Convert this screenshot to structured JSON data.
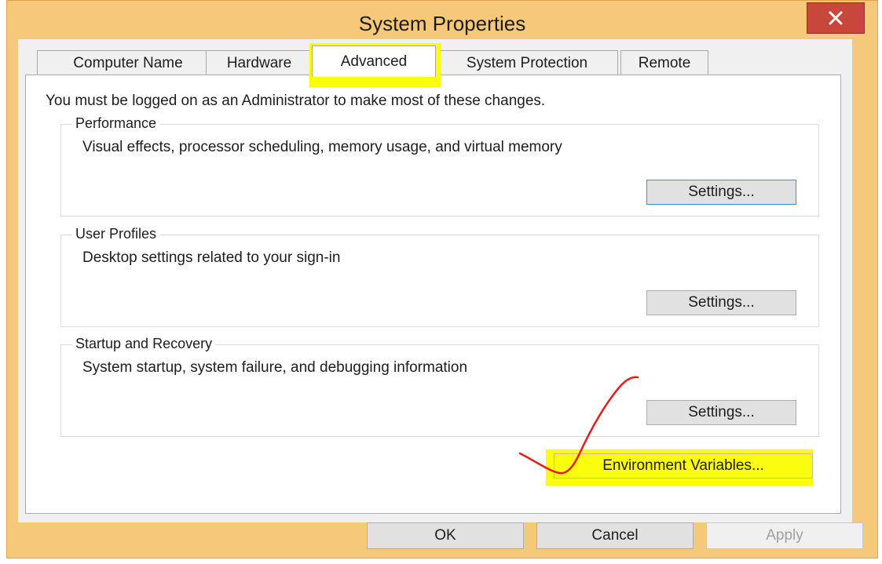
{
  "window": {
    "title": "System Properties"
  },
  "tabs": [
    {
      "label": "Computer Name",
      "active": false
    },
    {
      "label": "Hardware",
      "active": false
    },
    {
      "label": "Advanced",
      "active": true
    },
    {
      "label": "System Protection",
      "active": false
    },
    {
      "label": "Remote",
      "active": false
    }
  ],
  "admin_note": "You must be logged on as an Administrator to make most of these changes.",
  "groups": {
    "performance": {
      "title": "Performance",
      "description": "Visual effects, processor scheduling, memory usage, and virtual memory",
      "button": "Settings..."
    },
    "user_profiles": {
      "title": "User Profiles",
      "description": "Desktop settings related to your sign-in",
      "button": "Settings..."
    },
    "startup_recovery": {
      "title": "Startup and Recovery",
      "description": "System startup, system failure, and debugging information",
      "button": "Settings..."
    }
  },
  "environment_button": "Environment Variables...",
  "dialog_buttons": {
    "ok": "OK",
    "cancel": "Cancel",
    "apply": "Apply"
  },
  "icons": {
    "close": "close-icon"
  },
  "colors": {
    "highlight": "#fafd0e",
    "annotation_stroke": "#e0201b",
    "close_button": "#c9463d",
    "frame": "#f6c87a"
  }
}
